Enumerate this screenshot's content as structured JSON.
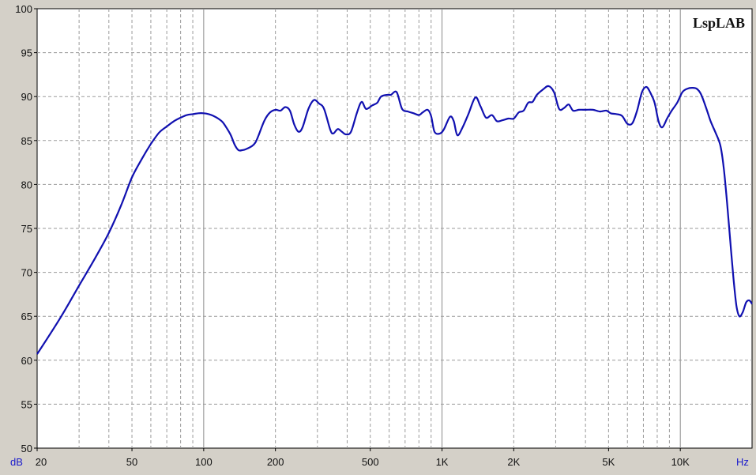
{
  "brand": "LspLAB",
  "chart_data": {
    "type": "line",
    "title": "",
    "xlabel": "Hz",
    "ylabel": "dB",
    "x_scale": "log",
    "xlim": [
      20,
      20000
    ],
    "ylim": [
      50,
      100
    ],
    "grid": true,
    "y_ticks": [
      "100",
      "95",
      "90",
      "85",
      "80",
      "75",
      "70",
      "65",
      "60",
      "55",
      "50"
    ],
    "x_ticks": [
      {
        "value": 20,
        "label": "20"
      },
      {
        "value": 50,
        "label": "50"
      },
      {
        "value": 100,
        "label": "100"
      },
      {
        "value": 200,
        "label": "200"
      },
      {
        "value": 500,
        "label": "500"
      },
      {
        "value": 1000,
        "label": "1K"
      },
      {
        "value": 2000,
        "label": "2K"
      },
      {
        "value": 5000,
        "label": "5K"
      },
      {
        "value": 10000,
        "label": "10K"
      }
    ],
    "series": [
      {
        "color": "#1010b0",
        "points": [
          [
            20,
            60.7
          ],
          [
            25,
            64.8
          ],
          [
            30,
            68.5
          ],
          [
            35,
            71.6
          ],
          [
            40,
            74.5
          ],
          [
            45,
            77.6
          ],
          [
            50,
            80.8
          ],
          [
            55,
            82.9
          ],
          [
            60,
            84.6
          ],
          [
            65,
            85.9
          ],
          [
            70,
            86.6
          ],
          [
            75,
            87.2
          ],
          [
            80,
            87.6
          ],
          [
            85,
            87.9
          ],
          [
            90,
            88.0
          ],
          [
            95,
            88.1
          ],
          [
            100,
            88.1
          ],
          [
            105,
            88.0
          ],
          [
            110,
            87.8
          ],
          [
            115,
            87.5
          ],
          [
            120,
            87.1
          ],
          [
            125,
            86.4
          ],
          [
            130,
            85.6
          ],
          [
            135,
            84.5
          ],
          [
            140,
            83.9
          ],
          [
            145,
            83.9
          ],
          [
            150,
            84.0
          ],
          [
            160,
            84.4
          ],
          [
            165,
            84.8
          ],
          [
            170,
            85.6
          ],
          [
            180,
            87.3
          ],
          [
            190,
            88.2
          ],
          [
            200,
            88.5
          ],
          [
            210,
            88.4
          ],
          [
            220,
            88.8
          ],
          [
            230,
            88.4
          ],
          [
            240,
            86.8
          ],
          [
            250,
            86.0
          ],
          [
            260,
            86.5
          ],
          [
            275,
            88.6
          ],
          [
            290,
            89.6
          ],
          [
            305,
            89.2
          ],
          [
            320,
            88.6
          ],
          [
            340,
            86.2
          ],
          [
            350,
            85.8
          ],
          [
            365,
            86.3
          ],
          [
            380,
            86.0
          ],
          [
            395,
            85.7
          ],
          [
            415,
            86.0
          ],
          [
            440,
            88.2
          ],
          [
            460,
            89.4
          ],
          [
            480,
            88.6
          ],
          [
            510,
            89.0
          ],
          [
            535,
            89.3
          ],
          [
            555,
            90.0
          ],
          [
            590,
            90.2
          ],
          [
            610,
            90.2
          ],
          [
            645,
            90.5
          ],
          [
            680,
            88.6
          ],
          [
            720,
            88.3
          ],
          [
            760,
            88.1
          ],
          [
            800,
            87.9
          ],
          [
            830,
            88.2
          ],
          [
            870,
            88.5
          ],
          [
            900,
            87.8
          ],
          [
            930,
            86.0
          ],
          [
            980,
            85.8
          ],
          [
            1020,
            86.3
          ],
          [
            1080,
            87.7
          ],
          [
            1120,
            87.2
          ],
          [
            1160,
            85.6
          ],
          [
            1220,
            86.5
          ],
          [
            1290,
            88.0
          ],
          [
            1380,
            89.9
          ],
          [
            1450,
            88.9
          ],
          [
            1530,
            87.6
          ],
          [
            1620,
            87.9
          ],
          [
            1700,
            87.2
          ],
          [
            1790,
            87.3
          ],
          [
            1900,
            87.5
          ],
          [
            2000,
            87.5
          ],
          [
            2100,
            88.2
          ],
          [
            2200,
            88.4
          ],
          [
            2300,
            89.3
          ],
          [
            2400,
            89.4
          ],
          [
            2500,
            90.2
          ],
          [
            2650,
            90.8
          ],
          [
            2800,
            91.2
          ],
          [
            2950,
            90.5
          ],
          [
            3100,
            88.6
          ],
          [
            3250,
            88.7
          ],
          [
            3400,
            89.1
          ],
          [
            3550,
            88.4
          ],
          [
            3750,
            88.5
          ],
          [
            4000,
            88.5
          ],
          [
            4300,
            88.5
          ],
          [
            4600,
            88.3
          ],
          [
            4900,
            88.4
          ],
          [
            5100,
            88.1
          ],
          [
            5400,
            88.0
          ],
          [
            5700,
            87.8
          ],
          [
            6000,
            86.9
          ],
          [
            6300,
            87.0
          ],
          [
            6600,
            88.5
          ],
          [
            6900,
            90.5
          ],
          [
            7200,
            91.1
          ],
          [
            7500,
            90.4
          ],
          [
            7800,
            89.3
          ],
          [
            8100,
            87.2
          ],
          [
            8400,
            86.5
          ],
          [
            8800,
            87.5
          ],
          [
            9200,
            88.4
          ],
          [
            9700,
            89.3
          ],
          [
            10200,
            90.5
          ],
          [
            10700,
            90.9
          ],
          [
            11200,
            91.0
          ],
          [
            11700,
            90.9
          ],
          [
            12200,
            90.3
          ],
          [
            12800,
            88.8
          ],
          [
            13400,
            87.2
          ],
          [
            14000,
            86.0
          ],
          [
            14700,
            84.5
          ],
          [
            15200,
            82.0
          ],
          [
            15700,
            78.0
          ],
          [
            16200,
            73.6
          ],
          [
            16700,
            69.4
          ],
          [
            17200,
            66.2
          ],
          [
            17700,
            65.0
          ],
          [
            18300,
            65.5
          ],
          [
            18900,
            66.6
          ],
          [
            19500,
            66.8
          ],
          [
            20000,
            66.4
          ]
        ]
      }
    ]
  }
}
